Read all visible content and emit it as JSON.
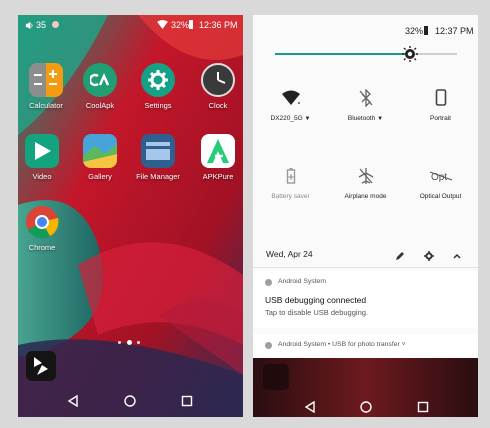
{
  "left_screen": {
    "status": {
      "left_text": "35",
      "battery": "32%",
      "time": "12:36 PM"
    },
    "apps": [
      {
        "name": "Calculator",
        "color": "#f39c12"
      },
      {
        "name": "CoolApk",
        "color": "#1f9f73"
      },
      {
        "name": "Settings",
        "color": "#16a085"
      },
      {
        "name": "Clock",
        "color": "#4a4a4a"
      },
      {
        "name": "Video",
        "color": "#14a37f"
      },
      {
        "name": "Gallery",
        "color": "#46a4d8"
      },
      {
        "name": "File Manager",
        "color": "#2f5f8f"
      },
      {
        "name": "APKPure",
        "color": "#ffffff"
      },
      {
        "name": "Chrome",
        "color": "#ffffff"
      }
    ]
  },
  "right_screen": {
    "status": {
      "battery": "32%",
      "time": "12:37 PM"
    },
    "brightness": 0.74,
    "tiles": [
      {
        "label": "DX220_5G",
        "dropdown": true,
        "icon": "wifi-icon",
        "active": true
      },
      {
        "label": "Bluetooth",
        "dropdown": true,
        "icon": "bluetooth-off-icon",
        "active": true
      },
      {
        "label": "Portrait",
        "dropdown": false,
        "icon": "portrait-icon",
        "active": true
      },
      {
        "label": "Battery saver",
        "dropdown": false,
        "icon": "battery-icon",
        "active": false
      },
      {
        "label": "Airplane mode",
        "dropdown": false,
        "icon": "airplane-off-icon",
        "active": true
      },
      {
        "label": "Optical Output",
        "dropdown": false,
        "icon": "optical-icon",
        "active": true
      }
    ],
    "date": "Wed, Apr 24",
    "notification1": {
      "app": "Android System",
      "title": "USB debugging connected",
      "body": "Tap to disable USB debugging."
    },
    "notification2": {
      "text": "Android System • USB for photo transfer ˅"
    }
  }
}
